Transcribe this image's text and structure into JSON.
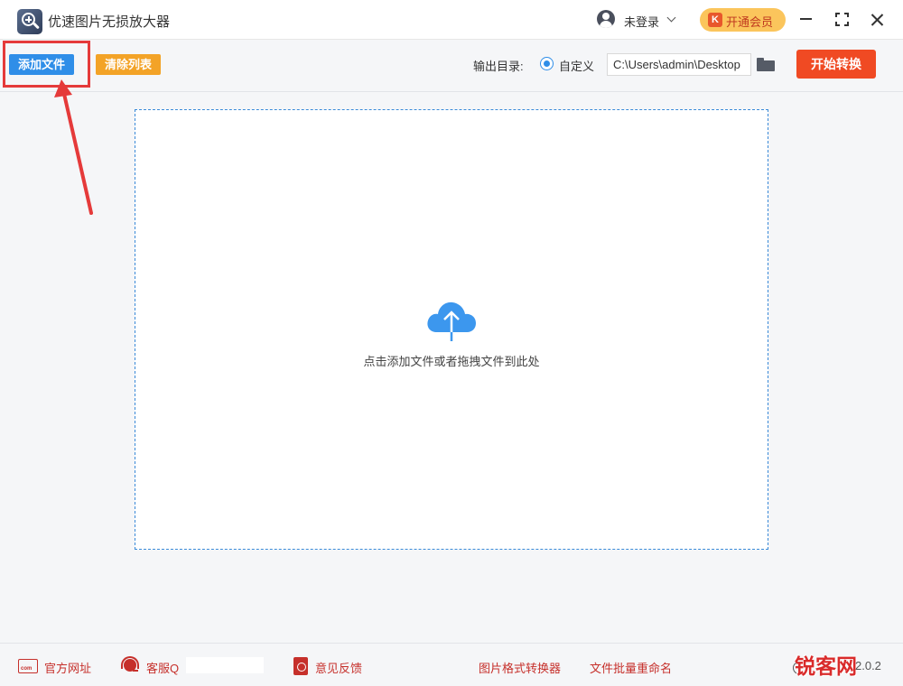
{
  "titlebar": {
    "app_title": "优速图片无损放大器",
    "login_label": "未登录",
    "vip_badge": "K",
    "vip_label": "开通会员"
  },
  "toolbar": {
    "add_file_label": "添加文件",
    "clear_list_label": "清除列表",
    "output_dir_label": "输出目录:",
    "custom_radio_label": "自定义",
    "output_path_value": "C:\\Users\\admin\\Desktop",
    "start_label": "开始转换"
  },
  "dropzone": {
    "hint": "点击添加文件或者拖拽文件到此处"
  },
  "footer": {
    "official_site": "官方网址",
    "com_icon_text": "com",
    "service_label": "客服Q",
    "feedback": "意见反馈",
    "format_converter": "图片格式转换器",
    "batch_rename": "文件批量重命名",
    "version": "2.0.2",
    "watermark": "锐客网"
  },
  "colors": {
    "primary_blue": "#2f8ee8",
    "clear_orange": "#f3a327",
    "start_red": "#f04a23",
    "vip_gold": "#fbc55c",
    "footer_red": "#c6302b",
    "annotation_red": "#e53a3a"
  },
  "icons": [
    "app-logo-icon",
    "user-icon",
    "chevron-down-icon",
    "vip-icon",
    "minimize-icon",
    "maximize-icon",
    "close-icon",
    "folder-icon",
    "cloud-upload-icon",
    "website-icon",
    "customer-service-icon",
    "feedback-icon",
    "version-icon"
  ]
}
